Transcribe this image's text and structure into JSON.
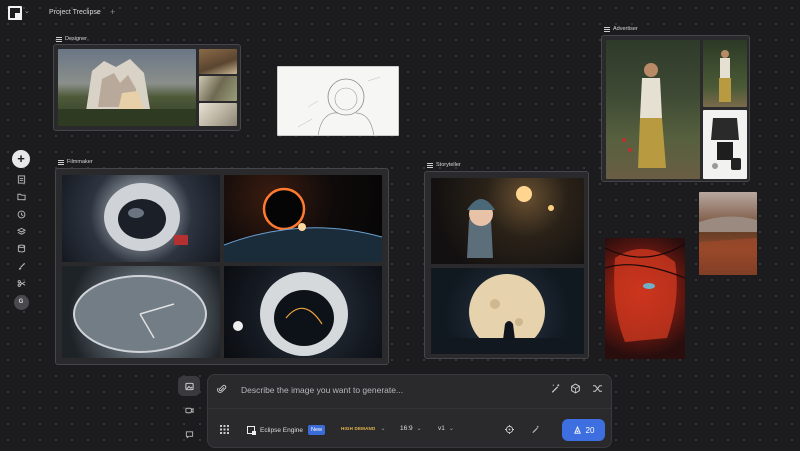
{
  "header": {
    "project_name": "Project Treclipse",
    "caret": "⌄",
    "add_tab": "+"
  },
  "rail": {
    "plus": "+",
    "avatar": "G",
    "items": [
      "page-icon",
      "folder-icon",
      "clock-icon",
      "layers-icon",
      "database-icon",
      "brush-icon",
      "scissors-icon"
    ]
  },
  "boards": {
    "designer": "Designer",
    "filmmaker": "Filmmaker",
    "storyteller": "Storyteller",
    "advertiser": "Advertiser"
  },
  "prompt": {
    "placeholder": "Describe the image you want to generate...",
    "engine": "Eclipse Engine",
    "new_badge": "New",
    "demand": "HIGH DEMAND",
    "ratio": "16:9",
    "version": "v1",
    "count": "20"
  },
  "colors": {
    "background": "#1c1c1e",
    "panel": "#2a2a2d",
    "accent": "#3d6fe0",
    "demand": "#e8b84a"
  }
}
